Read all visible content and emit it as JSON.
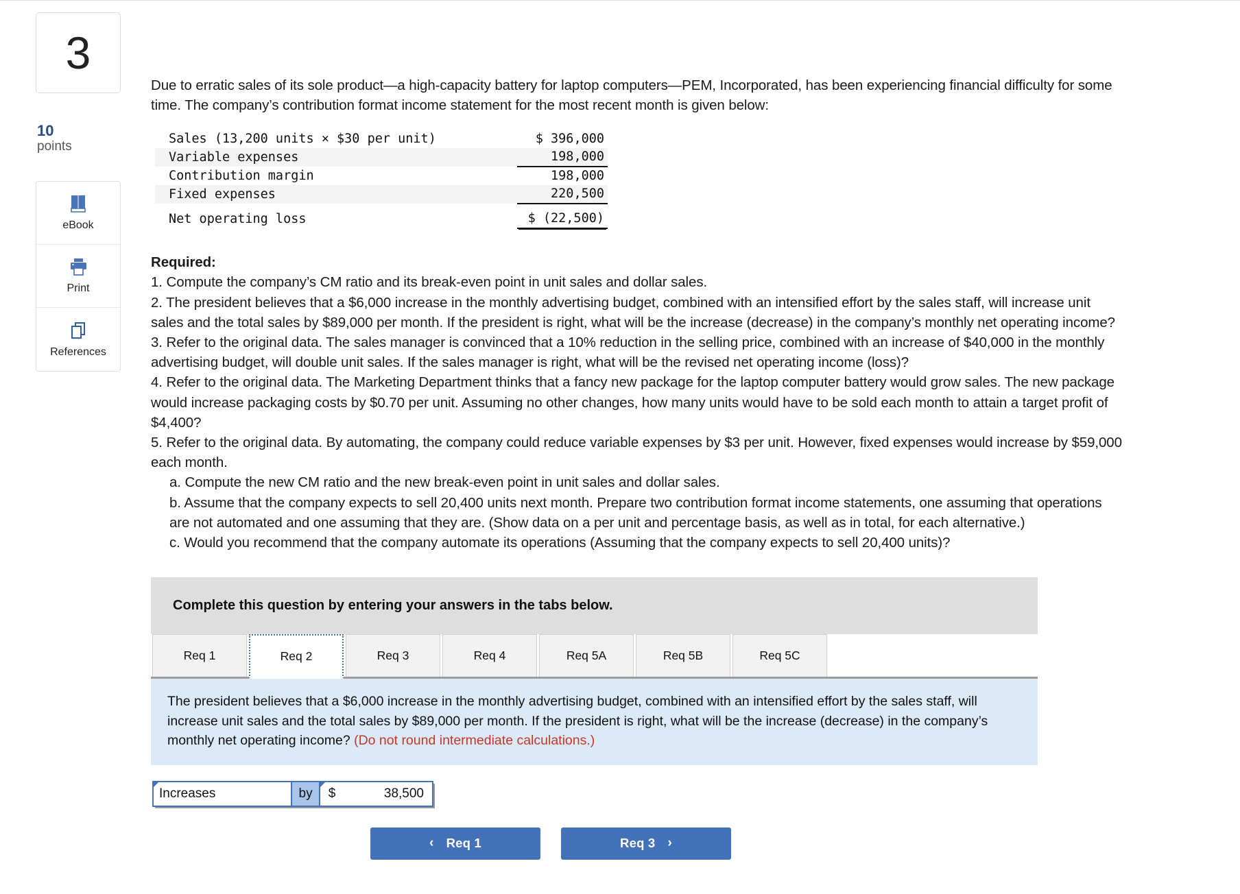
{
  "sidebar": {
    "question_number": "3",
    "points_value": "10",
    "points_label": "points",
    "tools": [
      {
        "icon": "ebook-icon",
        "label": "eBook"
      },
      {
        "icon": "print-icon",
        "label": "Print"
      },
      {
        "icon": "references-icon",
        "label": "References"
      }
    ]
  },
  "intro": "Due to erratic sales of its sole product—a high-capacity battery for laptop computers—PEM, Incorporated, has been experiencing financial difficulty for some time. The company’s contribution format income statement for the most recent month is given below:",
  "statement": {
    "rows": [
      {
        "label": "Sales (13,200 units × $30 per unit)",
        "amount": "$ 396,000",
        "shade": false,
        "underline": false
      },
      {
        "label": "Variable expenses",
        "amount": "198,000",
        "shade": true,
        "underline": true
      },
      {
        "label": "Contribution margin",
        "amount": "198,000",
        "shade": false,
        "underline": false
      },
      {
        "label": "Fixed expenses",
        "amount": "220,500",
        "shade": true,
        "underline": true
      },
      {
        "label": "Net operating loss",
        "amount": "$ (22,500)",
        "shade": false,
        "underline": false,
        "double": true
      }
    ]
  },
  "required": {
    "heading": "Required:",
    "items": [
      "1. Compute the company’s CM ratio and its break-even point in unit sales and dollar sales.",
      "2. The president believes that a $6,000 increase in the monthly advertising budget, combined with an intensified effort by the sales staff, will increase unit sales and the total sales by $89,000 per month. If the president is right, what will be the increase (decrease) in the company’s monthly net operating income?",
      "3. Refer to the original data. The sales manager is convinced that a 10% reduction in the selling price, combined with an increase of $40,000 in the monthly advertising budget, will double unit sales. If the sales manager is right, what will be the revised net operating income (loss)?",
      "4. Refer to the original data. The Marketing Department thinks that a fancy new package for the laptop computer battery would grow sales. The new package would increase packaging costs by $0.70 per unit. Assuming no other changes, how many units would have to be sold each month to attain a target profit of $4,400?",
      "5. Refer to the original data. By automating, the company could reduce variable expenses by $3 per unit. However, fixed expenses would increase by $59,000 each month."
    ],
    "sub_items": [
      "a. Compute the new CM ratio and the new break-even point in unit sales and dollar sales.",
      "b. Assume that the company expects to sell 20,400 units next month. Prepare two contribution format income statements, one assuming that operations are not automated and one assuming that they are. (Show data on a per unit and percentage basis, as well as in total, for each alternative.)",
      "c. Would you recommend that the company automate its operations (Assuming that the company expects to sell 20,400 units)?"
    ]
  },
  "banner": {
    "text": "Complete this question by entering your answers in the tabs below."
  },
  "tabs": {
    "items": [
      {
        "label": "Req 1",
        "active": false
      },
      {
        "label": "Req 2",
        "active": true
      },
      {
        "label": "Req 3",
        "active": false
      },
      {
        "label": "Req 4",
        "active": false
      },
      {
        "label": "Req 5A",
        "active": false
      },
      {
        "label": "Req 5B",
        "active": false
      },
      {
        "label": "Req 5C",
        "active": false
      }
    ]
  },
  "question_panel": {
    "body": "The president believes that a $6,000 increase in the monthly advertising budget, combined with an intensified effort by the sales staff, will increase unit sales and the total sales by $89,000 per month. If the president is right, what will be the increase (decrease) in the company’s monthly net operating income? ",
    "note": "(Do not round intermediate calculations.)"
  },
  "answer_row": {
    "direction": "Increases",
    "connector": "by",
    "currency": "$",
    "value": "38,500"
  },
  "nav": {
    "prev_chevron": "‹",
    "prev_label": "Req 1",
    "next_label": "Req 3",
    "next_chevron": "›"
  },
  "colors": {
    "accent_blue": "#4472b8",
    "panel_blue": "#dce9f7",
    "banner_gray": "#dedede",
    "note_red": "#c0392b",
    "points_blue": "#2b4a7d"
  }
}
